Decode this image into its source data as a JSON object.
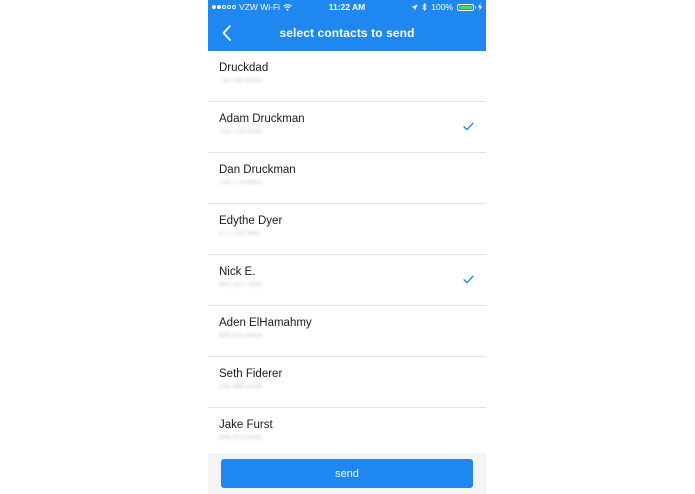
{
  "status_bar": {
    "carrier": "VZW Wi-Fi",
    "time": "11:22 AM",
    "battery_percent": "100%",
    "signal_bars_filled": 2,
    "signal_bars_total": 5,
    "battery_level": 1.0
  },
  "nav": {
    "title": "select contacts to send",
    "back_icon": "chevron-left-icon"
  },
  "contacts": [
    {
      "name": "Druckdad",
      "phone": "732-290-8035",
      "selected": false
    },
    {
      "name": "Adam Druckman",
      "phone": "732-718-9430",
      "selected": true
    },
    {
      "name": "Dan Druckman",
      "phone": "732-773-8853",
      "selected": false
    },
    {
      "name": "Edythe Dyer",
      "phone": "877-764-4687",
      "selected": false
    },
    {
      "name": "Nick E.",
      "phone": "862-257-7653",
      "selected": true
    },
    {
      "name": "Aden ElHamahmy",
      "phone": "609-915-4656",
      "selected": false
    },
    {
      "name": "Seth Fiderer",
      "phone": "908-966-0536",
      "selected": false
    },
    {
      "name": "Jake Furst",
      "phone": "646-912-5925",
      "selected": false
    }
  ],
  "footer": {
    "send_label": "send"
  },
  "colors": {
    "primary": "#1e88f0",
    "check": "#1e88f0",
    "battery": "#4cd964"
  }
}
